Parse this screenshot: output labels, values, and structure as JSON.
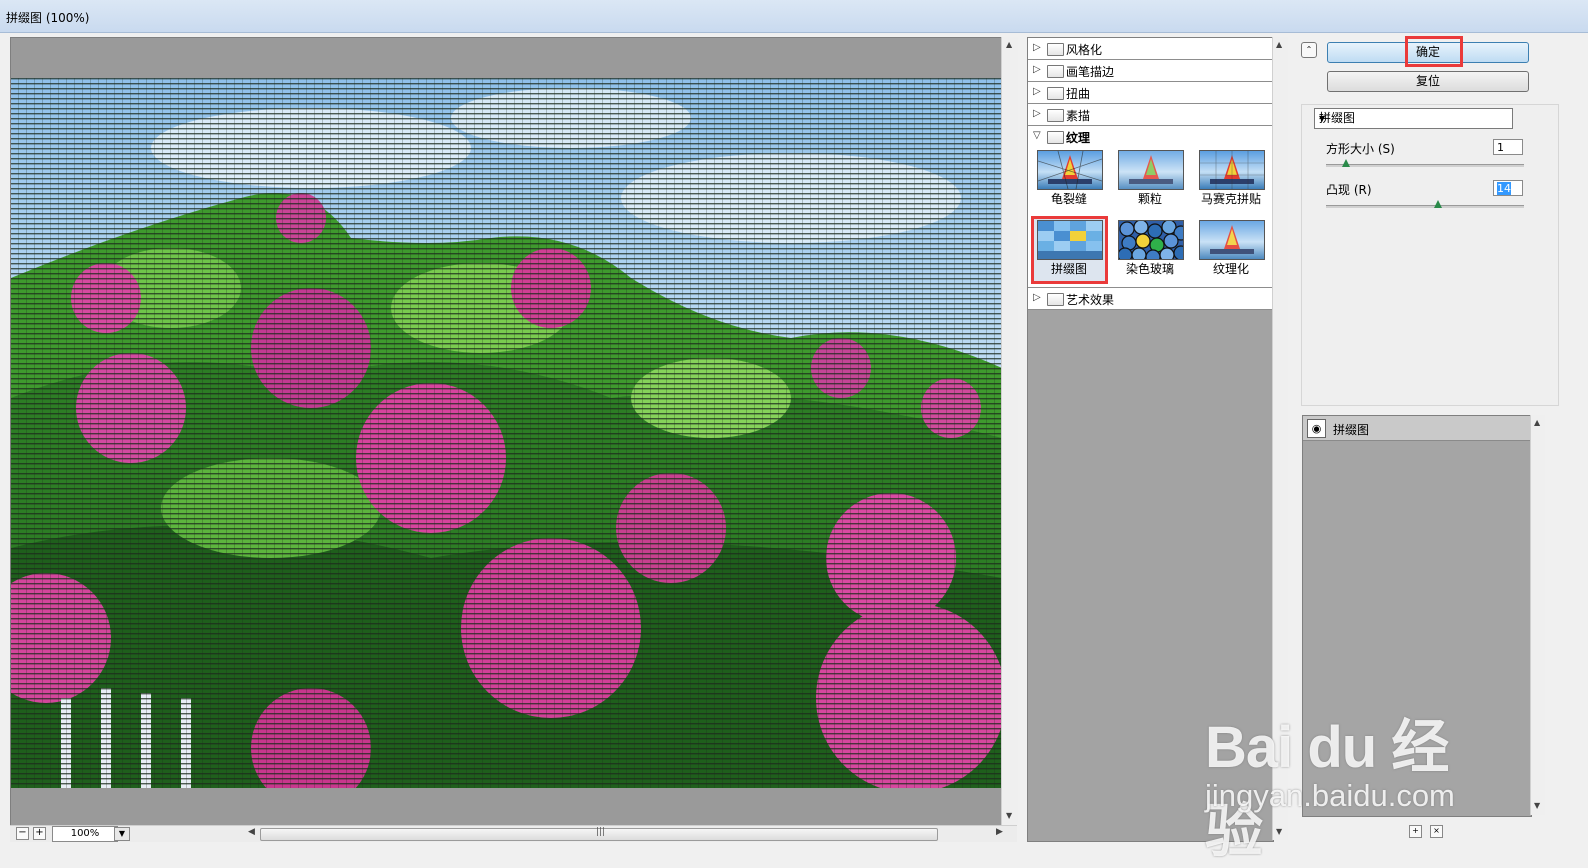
{
  "window": {
    "title": "拼缀图 (100%)"
  },
  "preview": {
    "zoom": "100%",
    "zoom_out_label": "−",
    "zoom_in_label": "+"
  },
  "gallery": {
    "categories": [
      {
        "label": "风格化",
        "expanded": false
      },
      {
        "label": "画笔描边",
        "expanded": false
      },
      {
        "label": "扭曲",
        "expanded": false
      },
      {
        "label": "素描",
        "expanded": false
      },
      {
        "label": "纹理",
        "expanded": true
      },
      {
        "label": "艺术效果",
        "expanded": false
      }
    ],
    "texture_filters": [
      "龟裂缝",
      "颗粒",
      "马赛克拼贴",
      "拼缀图",
      "染色玻璃",
      "纹理化"
    ],
    "selected_filter": "拼缀图"
  },
  "buttons": {
    "ok_label": "确定",
    "reset_label": "复位"
  },
  "settings": {
    "filter_select": "拼缀图",
    "square_size": {
      "label": "方形大小 (S)",
      "value": "1",
      "level": 0.1
    },
    "relief": {
      "label": "凸现 (R)",
      "value": "14",
      "level": 0.56
    }
  },
  "layers": {
    "items": [
      "拼缀图"
    ]
  },
  "watermark": {
    "brand": "Bai du 经验",
    "url": "jingyan.baidu.com"
  },
  "colors": {
    "highlight": "#ea3a3a",
    "ok_button": "#bfdcf3",
    "selection": "#3399ff"
  }
}
